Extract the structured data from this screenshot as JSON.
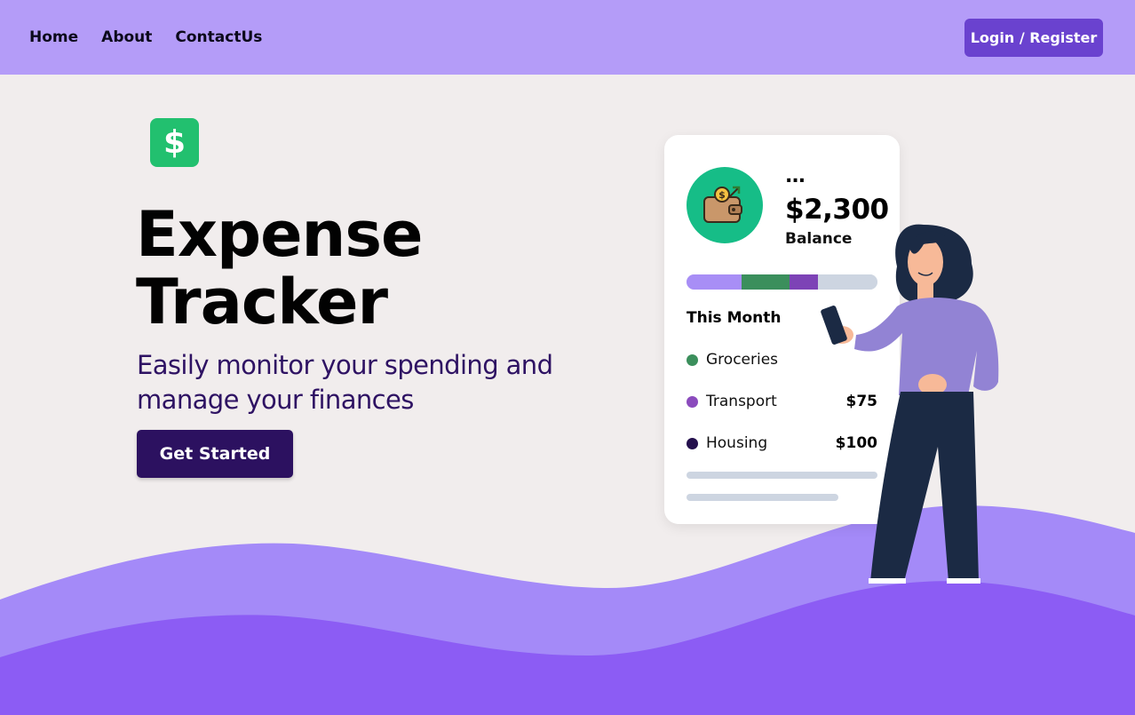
{
  "nav": {
    "links": [
      "Home",
      "About",
      "ContactUs"
    ],
    "login_label": "Login / Register"
  },
  "hero": {
    "logo_symbol": "$",
    "title_line1": "Expense",
    "title_line2": "Tracker",
    "subtitle_line1": "Easily monitor your spending and",
    "subtitle_line2": "manage your finances",
    "cta_label": "Get Started"
  },
  "card": {
    "dots": "...",
    "balance": "$2,300",
    "balance_label": "Balance",
    "month_title": "This Month",
    "expenses": [
      {
        "name": "Groceries",
        "amount": "",
        "color": "#3b8f5c"
      },
      {
        "name": "Transport",
        "amount": "$75",
        "color": "#8b4bbd"
      },
      {
        "name": "Housing",
        "amount": "$100",
        "color": "#24104d"
      }
    ],
    "progress_segments": [
      {
        "color": "#a88ef6",
        "fraction": 0.29
      },
      {
        "color": "#3b8f5c",
        "fraction": 0.25
      },
      {
        "color": "#7d43b6",
        "fraction": 0.15
      },
      {
        "color": "#cdd5e1",
        "fraction": 0.31
      }
    ]
  },
  "colors": {
    "nav_bg": "#b49cf8",
    "accent": "#6a42cf",
    "cta": "#2c1160",
    "logo_green": "#22c06f",
    "wallet_green": "#16bd87",
    "wave_light": "#a48af8",
    "wave_dark": "#8c5cf4"
  },
  "icons": {
    "logo": "dollar-icon",
    "wallet": "wallet-icon"
  }
}
